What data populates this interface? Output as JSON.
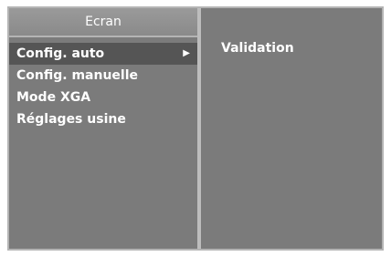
{
  "menu": {
    "title": "Ecran",
    "items": [
      {
        "label": "Config. auto",
        "arrow": "▶"
      },
      {
        "label": "Config. manuelle"
      },
      {
        "label": "Mode XGA"
      },
      {
        "label": "Réglages usine"
      }
    ]
  },
  "submenu": {
    "label": "Validation"
  },
  "icons": {
    "selected_item_arrow": "right-arrow-icon"
  },
  "colors": {
    "panel_background": "#7b7b7b",
    "border": "#b4b4b4",
    "selected_background": "#555555",
    "text": "#ffffff"
  }
}
